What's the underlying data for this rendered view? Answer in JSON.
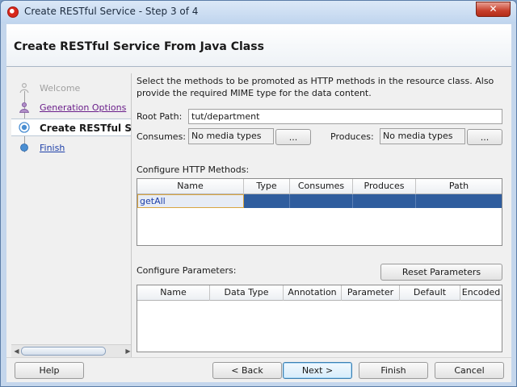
{
  "window": {
    "title": "Create RESTful Service - Step 3 of 4",
    "close_glyph": "✕"
  },
  "header": {
    "title": "Create RESTful Service From Java Class"
  },
  "nav": {
    "items": [
      {
        "label": "Welcome",
        "state": "done"
      },
      {
        "label": "Generation Options",
        "state": "visited"
      },
      {
        "label": "Create RESTful Servi",
        "state": "current"
      },
      {
        "label": "Finish",
        "state": "link"
      }
    ]
  },
  "main": {
    "description": "Select the methods to be promoted as HTTP methods in the resource class. Also provide the required MIME type for the data content.",
    "root_path_label": "Root Path:",
    "root_path_value": "tut/department",
    "consumes_label": "Consumes:",
    "consumes_value": "No media types",
    "produces_label": "Produces:",
    "produces_value": "No media types",
    "ellipsis_label": "...",
    "methods_label": "Configure HTTP Methods:",
    "methods_table": {
      "columns": [
        "Name",
        "Type",
        "Consumes",
        "Produces",
        "Path"
      ],
      "rows": [
        {
          "name": "getAll",
          "type": "",
          "consumes": "",
          "produces": "",
          "path": ""
        }
      ]
    },
    "params_label": "Configure Parameters:",
    "reset_button": "Reset Parameters",
    "params_table": {
      "columns": [
        "Name",
        "Data Type",
        "Annotation",
        "Parameter",
        "Default",
        "Encoded"
      ]
    }
  },
  "footer": {
    "help": "Help",
    "back": "< Back",
    "next": "Next >",
    "finish": "Finish",
    "cancel": "Cancel"
  },
  "colors": {
    "selection": "#2f5d9e",
    "link": "#1c3ea8",
    "visited_link": "#6a1e8a",
    "window_frame": "#c4d6ec"
  }
}
